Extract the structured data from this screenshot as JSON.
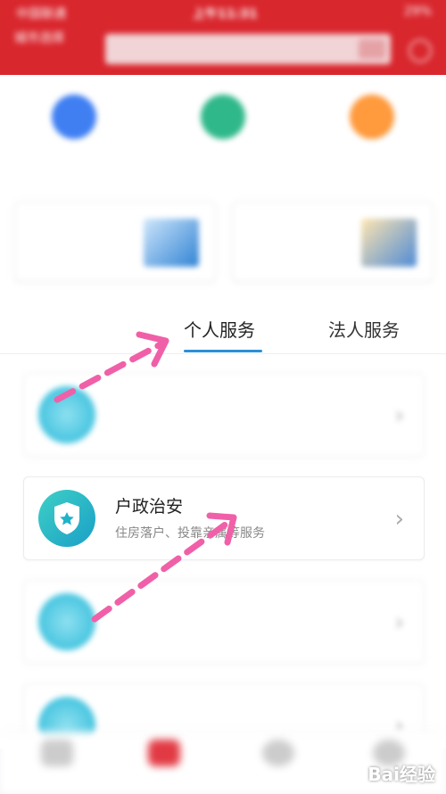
{
  "status_bar": {
    "carrier": "中国联通",
    "time": "上午11:31",
    "battery": "29%"
  },
  "header": {
    "city": "城市选择",
    "search_placeholder": "",
    "brand_color": "#d9272e"
  },
  "quick_links": [
    {
      "label": "",
      "color": "#3f7ff2"
    },
    {
      "label": "",
      "color": "#2fb88a"
    },
    {
      "label": "",
      "color": "#ff9a3d"
    }
  ],
  "cards": [
    {
      "title": "",
      "subtitle": ""
    },
    {
      "title": "",
      "subtitle": ""
    }
  ],
  "tabs": [
    {
      "label": ""
    },
    {
      "label": "个人服务",
      "active": true
    },
    {
      "label": "法人服务"
    }
  ],
  "services": [
    {
      "title": "",
      "desc": "",
      "icon": "user-icon"
    },
    {
      "title": "户政治安",
      "desc": "住房落户、投靠亲属等服务",
      "icon": "shield-star-icon"
    },
    {
      "title": "",
      "desc": "",
      "icon": "card-icon"
    },
    {
      "title": "",
      "desc": "",
      "icon": "heart-icon"
    }
  ],
  "bottom_nav": [
    {
      "label": "",
      "icon": "home-icon"
    },
    {
      "label": "",
      "icon": "service-icon"
    },
    {
      "label": "",
      "icon": "compass-icon"
    },
    {
      "label": "",
      "icon": "user-icon"
    }
  ],
  "watermark": "Bai经验",
  "accent_color": "#2d8fd6",
  "arrow_color": "#f060a8"
}
